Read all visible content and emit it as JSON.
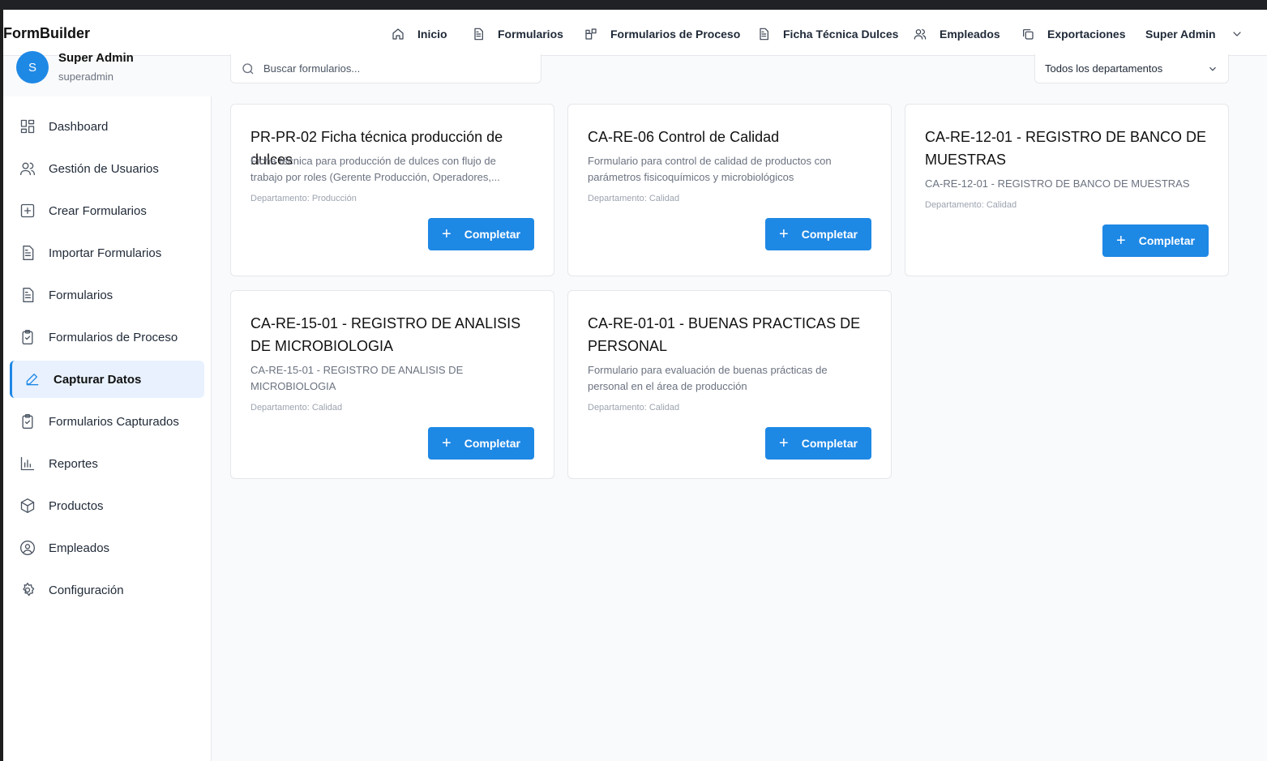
{
  "app": {
    "brand": "FormBuilder"
  },
  "topnav": {
    "items": [
      {
        "label": "Inicio",
        "icon": "home-icon"
      },
      {
        "label": "Formularios",
        "icon": "document-icon"
      },
      {
        "label": "Formularios de Proceso",
        "icon": "blocks-icon"
      },
      {
        "label": "Ficha Técnica Dulces",
        "icon": "document-icon"
      },
      {
        "label": "Empleados",
        "icon": "users-icon"
      },
      {
        "label": "Exportaciones",
        "icon": "copy-icon"
      }
    ],
    "user_menu": "Super Admin"
  },
  "sidebar": {
    "user": {
      "initial": "S",
      "name": "Super Admin",
      "login": "superadmin"
    },
    "items": [
      {
        "label": "Dashboard",
        "icon": "dashboard-icon"
      },
      {
        "label": "Gestión de Usuarios",
        "icon": "users-icon"
      },
      {
        "label": "Crear Formularios",
        "icon": "plus-square-icon"
      },
      {
        "label": "Importar Formularios",
        "icon": "document-icon"
      },
      {
        "label": "Formularios",
        "icon": "document-icon"
      },
      {
        "label": "Formularios de Proceso",
        "icon": "clipboard-icon"
      },
      {
        "label": "Capturar Datos",
        "icon": "pencil-icon",
        "active": true
      },
      {
        "label": "Formularios Capturados",
        "icon": "clipboard-check-icon"
      },
      {
        "label": "Reportes",
        "icon": "bar-chart-icon"
      },
      {
        "label": "Productos",
        "icon": "box-icon"
      },
      {
        "label": "Empleados",
        "icon": "user-circle-icon"
      },
      {
        "label": "Configuración",
        "icon": "gear-icon"
      }
    ]
  },
  "filters": {
    "search_placeholder": "Buscar formularios...",
    "department_selected": "Todos los departamentos"
  },
  "cards": [
    {
      "title": "PR-PR-02 Ficha técnica producción de dulces",
      "description": "Ficha técnica para producción de dulces con flujo de trabajo por roles (Gerente Producción, Operadores,...",
      "department": "Departamento: Producción",
      "button": "Completar"
    },
    {
      "title": "CA-RE-06 Control de Calidad",
      "description": "Formulario para control de calidad de productos con parámetros fisicoquímicos y microbiológicos",
      "department": "Departamento: Calidad",
      "button": "Completar"
    },
    {
      "title": "CA-RE-12-01 - REGISTRO DE BANCO DE MUESTRAS",
      "description": "CA-RE-12-01 - REGISTRO DE BANCO DE MUESTRAS",
      "department": "Departamento: Calidad",
      "button": "Completar"
    },
    {
      "title": "CA-RE-15-01 - REGISTRO DE ANALISIS DE MICROBIOLOGIA",
      "description": "CA-RE-15-01 - REGISTRO DE ANALISIS DE MICROBIOLOGIA",
      "department": "Departamento: Calidad",
      "button": "Completar"
    },
    {
      "title": "CA-RE-01-01 - BUENAS PRACTICAS DE PERSONAL",
      "description": "Formulario para evaluación de buenas prácticas de personal en el área de producción",
      "department": "Departamento: Calidad",
      "button": "Completar"
    }
  ],
  "colors": {
    "accent": "#1e88e5",
    "active_bg": "#e8f1fd"
  }
}
